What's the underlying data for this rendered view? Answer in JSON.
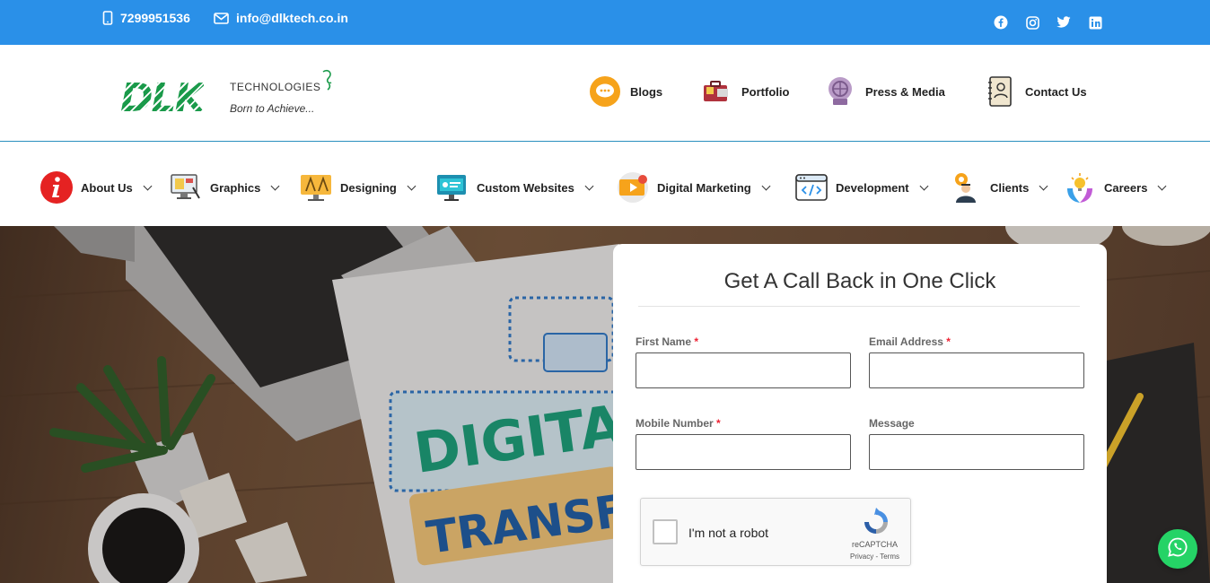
{
  "topbar": {
    "phone": "7299951536",
    "email": "info@dlktech.co.in",
    "social": [
      "facebook-icon",
      "instagram-icon",
      "twitter-icon",
      "linkedin-icon"
    ],
    "color": "#2a90e8"
  },
  "header": {
    "logo": {
      "mark": "DLK",
      "company": "TECHNOLOGIES",
      "tagline": "Born to Achieve..."
    },
    "links": [
      {
        "label": "Blogs",
        "icon": "chat-bubble-icon"
      },
      {
        "label": "Portfolio",
        "icon": "briefcase-icon"
      },
      {
        "label": "Press & Media",
        "icon": "microphone-icon"
      },
      {
        "label": "Contact Us",
        "icon": "address-book-icon"
      }
    ]
  },
  "nav": {
    "items": [
      {
        "label": "About Us",
        "icon": "info-icon"
      },
      {
        "label": "Graphics",
        "icon": "monitor-design-icon"
      },
      {
        "label": "Designing",
        "icon": "design-tools-icon"
      },
      {
        "label": "Custom Websites",
        "icon": "website-icon"
      },
      {
        "label": "Digital Marketing",
        "icon": "video-marketing-icon"
      },
      {
        "label": "Development",
        "icon": "code-icon"
      },
      {
        "label": "Clients",
        "icon": "clients-icon"
      },
      {
        "label": "Careers",
        "icon": "careers-icon"
      }
    ]
  },
  "form": {
    "title": "Get A Call Back in One Click",
    "fields": {
      "first_name": {
        "label": "First Name",
        "required_mark": "*",
        "value": ""
      },
      "email": {
        "label": "Email Address",
        "required_mark": "*",
        "value": ""
      },
      "mobile": {
        "label": "Mobile Number",
        "required_mark": "*",
        "value": ""
      },
      "message": {
        "label": "Message",
        "value": ""
      }
    },
    "captcha": {
      "label": "I'm not a robot",
      "brand": "reCAPTCHA",
      "terms": "Privacy - Terms"
    }
  },
  "colors": {
    "accent": "#2a90e8",
    "brand_green": "#1a9a4a",
    "required": "#e22233",
    "whatsapp": "#25d366"
  }
}
